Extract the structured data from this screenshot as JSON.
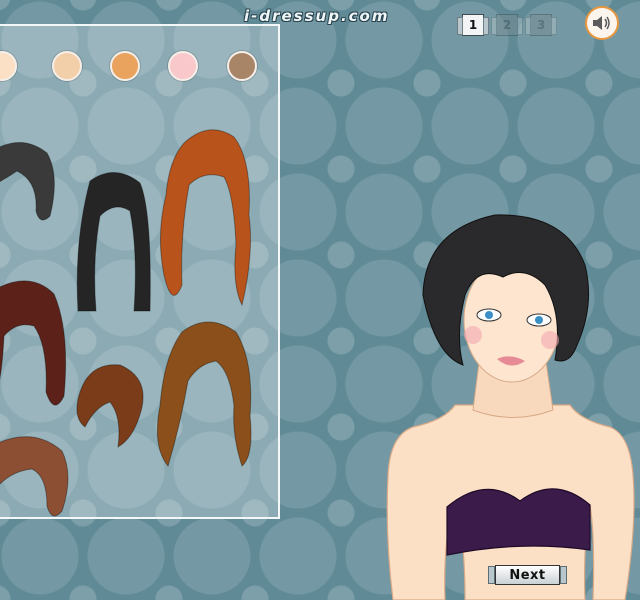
{
  "site": {
    "logo_text": "i-dressup.com"
  },
  "pages": {
    "items": [
      {
        "label": "1",
        "active": true
      },
      {
        "label": "2",
        "active": false
      },
      {
        "label": "3",
        "active": false
      }
    ]
  },
  "sound": {
    "icon": "speaker-icon"
  },
  "skin_tones": {
    "colors": [
      "#fbe0c6",
      "#f3cfa9",
      "#e9a35e",
      "#f9c8cb",
      "#a98567"
    ]
  },
  "hair_colors": {
    "black": "#262526",
    "dark_gray": "#3a3a3a",
    "auburn": "#b9531c",
    "mahogany": "#5c2219",
    "brown": "#7a3c19",
    "chestnut": "#8a4f1b",
    "light_brown": "#8c4f34"
  },
  "next_button": {
    "label": "Next"
  }
}
